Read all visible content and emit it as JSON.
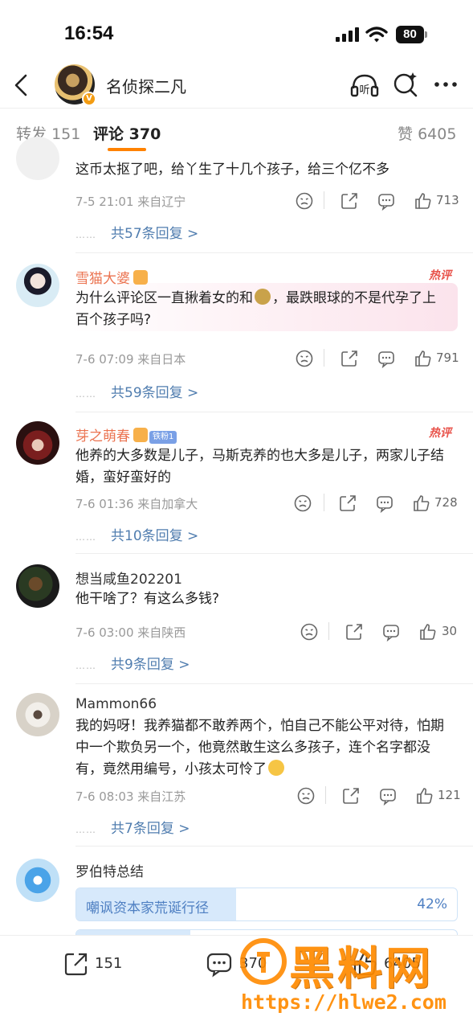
{
  "status_bar": {
    "time": "16:54",
    "battery": "80"
  },
  "header": {
    "title": "名侦探二凡",
    "listen_label": "听"
  },
  "tabs": [
    {
      "label": "转发",
      "count": "151"
    },
    {
      "label": "评论",
      "count": "370"
    },
    {
      "label": "赞",
      "count": "6405"
    }
  ],
  "comments": [
    {
      "username": "",
      "text": "这币太抠了吧，给丫生了十几个孩子，给三个亿不多",
      "meta": "7-5 21:01 来自辽宁",
      "likes": "713",
      "replies": "共57条回复 >"
    },
    {
      "username": "雪猫大婆",
      "hot": "热评",
      "text_a": "为什么评论区一直揪着女的和",
      "text_b": "，最跌眼球的不是代孕了上百个孩子吗?",
      "meta": "7-6 07:09 来自日本",
      "likes": "791",
      "replies": "共59条回复 >"
    },
    {
      "username": "芽之萌春",
      "fan_badge": "铁粉1",
      "hot": "热评",
      "text": "他养的大多数是儿子，马斯克养的也大多是儿子，两家儿子结婚，蛮好蛮好的",
      "meta": "7-6 01:36 来自加拿大",
      "likes": "728",
      "replies": "共10条回复 >"
    },
    {
      "username": "想当咸鱼202201",
      "text": "他干啥了？有这么多钱?",
      "meta": "7-6 03:00 来自陕西",
      "likes": "30",
      "replies": "共9条回复 >"
    },
    {
      "username": "Mammon66",
      "text": "我的妈呀！我养猫都不敢养两个，怕自己不能公平对待，怕期中一个欺负另一个，他竟然敢生这么多孩子，连个名字都没有，竟然用编号，小孩太可怜了",
      "meta": "7-6 08:03 来自江苏",
      "likes": "121",
      "replies": "共7条回复 >"
    },
    {
      "username": "罗伯特总结",
      "poll": {
        "option": "嘲讽资本家荒诞行径",
        "percent": "42%",
        "fraction": 0.42
      }
    }
  ],
  "reply_dots": "……",
  "bottom_bar": {
    "forward": "151",
    "comment": "370",
    "like": "6405"
  },
  "watermark": {
    "title": "黑料网",
    "url": "https://hlwe2.com"
  },
  "colors": {
    "accent": "#ff8200",
    "link": "#507daf",
    "hot": "#e8524a",
    "username": "#eb7350"
  }
}
